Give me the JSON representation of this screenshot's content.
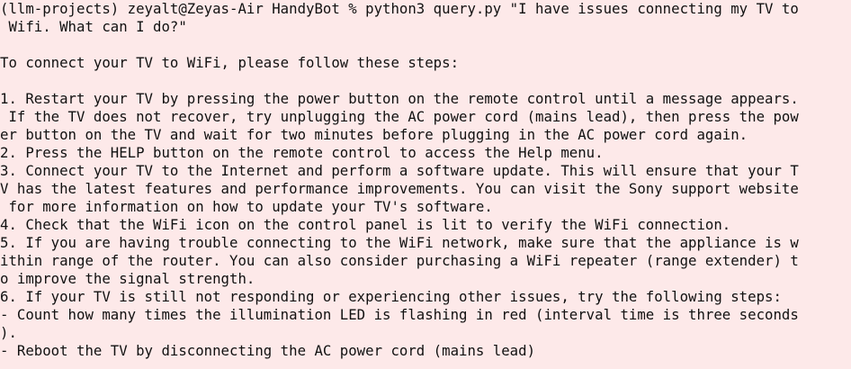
{
  "terminal": {
    "lines": [
      "(llm-projects) zeyalt@Zeyas-Air HandyBot % python3 query.py \"I have issues connecting my TV to",
      " Wifi. What can I do?\"",
      "",
      "To connect your TV to WiFi, please follow these steps:",
      "",
      "1. Restart your TV by pressing the power button on the remote control until a message appears.",
      " If the TV does not recover, try unplugging the AC power cord (mains lead), then press the pow",
      "er button on the TV and wait for two minutes before plugging in the AC power cord again.",
      "2. Press the HELP button on the remote control to access the Help menu.",
      "3. Connect your TV to the Internet and perform a software update. This will ensure that your T",
      "V has the latest features and performance improvements. You can visit the Sony support website",
      " for more information on how to update your TV's software.",
      "4. Check that the WiFi icon on the control panel is lit to verify the WiFi connection.",
      "5. If you are having trouble connecting to the WiFi network, make sure that the appliance is w",
      "ithin range of the router. You can also consider purchasing a WiFi repeater (range extender) t",
      "o improve the signal strength.",
      "6. If your TV is still not responding or experiencing other issues, try the following steps:",
      "- Count how many times the illumination LED is flashing in red (interval time is three seconds",
      ").",
      "- Reboot the TV by disconnecting the AC power cord (mains lead)"
    ]
  },
  "colors": {
    "background": "#fde9e9",
    "text": "#111111"
  }
}
